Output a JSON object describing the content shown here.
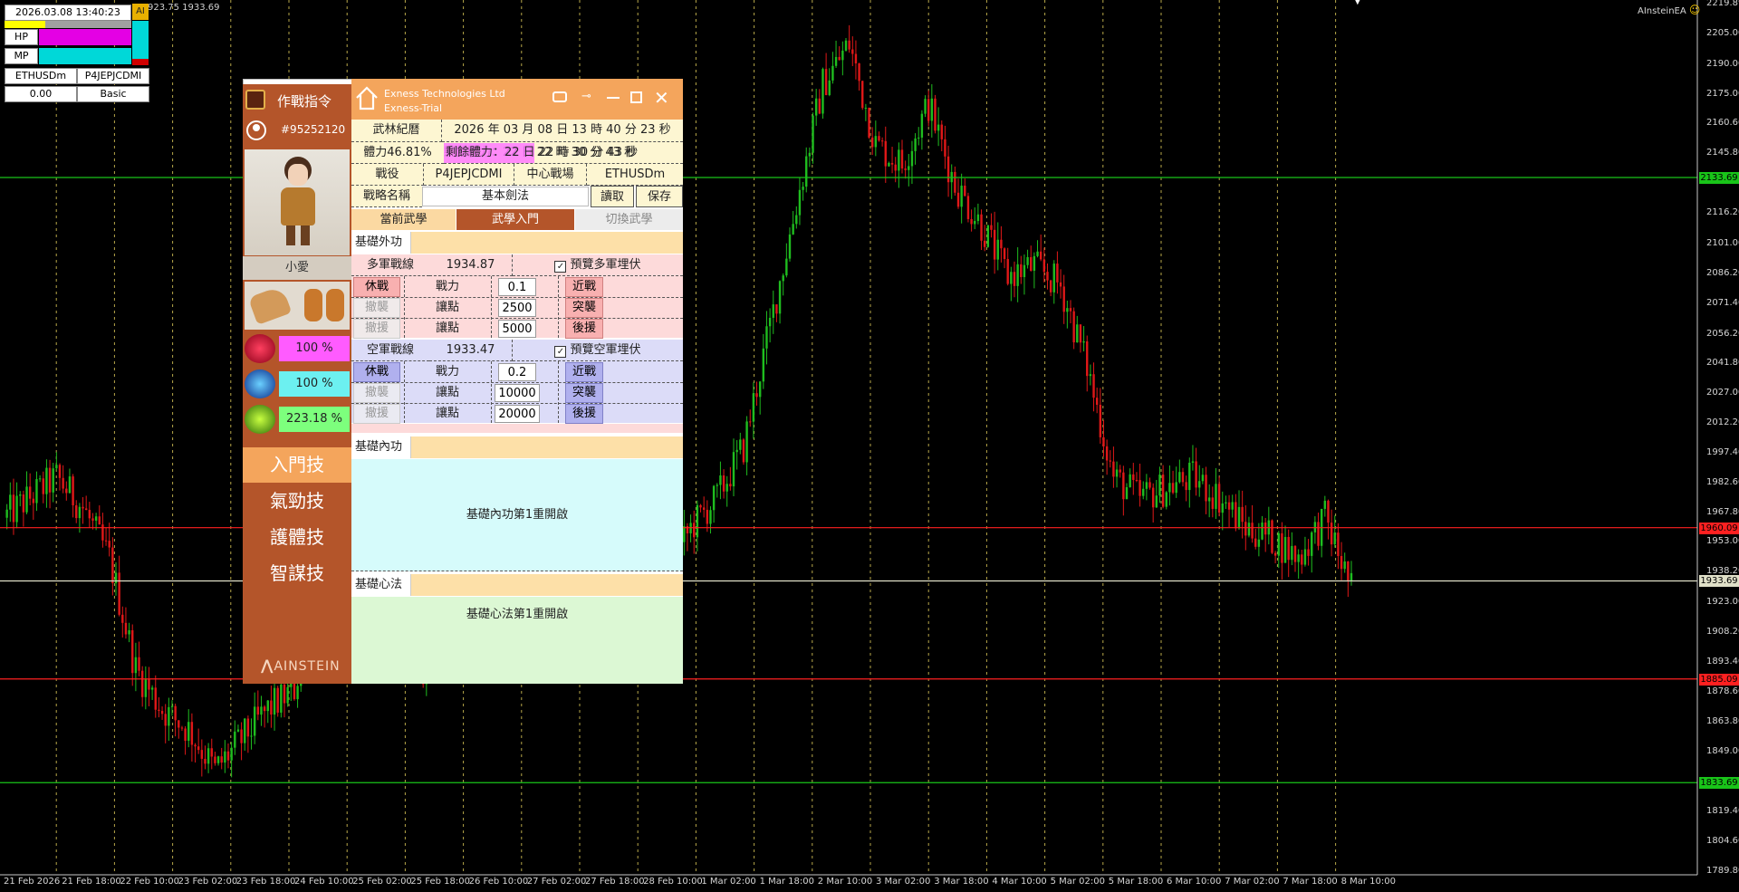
{
  "chart_data": {
    "type": "candlestick",
    "symbol": "ETHUSDm",
    "xlabels": [
      "21 Feb 2026",
      "21 Feb 18:00",
      "22 Feb 10:00",
      "23 Feb 02:00",
      "23 Feb 18:00",
      "24 Feb 10:00",
      "25 Feb 02:00",
      "25 Feb 18:00",
      "26 Feb 10:00",
      "27 Feb 02:00",
      "27 Feb 18:00",
      "28 Feb 10:00",
      "1 Mar 02:00",
      "1 Mar 18:00",
      "2 Mar 10:00",
      "3 Mar 02:00",
      "3 Mar 18:00",
      "4 Mar 10:00",
      "5 Mar 02:00",
      "5 Mar 18:00",
      "6 Mar 10:00",
      "7 Mar 02:00",
      "7 Mar 18:00",
      "8 Mar 10:00"
    ],
    "ylabels": [
      "2219.89",
      "2205.00",
      "2190.00",
      "2175.00",
      "2160.60",
      "2145.80",
      "2131.60",
      "2116.20",
      "2101.00",
      "2086.20",
      "2071.40",
      "2056.20",
      "2041.80",
      "2027.00",
      "2012.20",
      "1997.40",
      "1982.60",
      "1967.80",
      "1953.00",
      "1938.20",
      "1923.00",
      "1908.20",
      "1893.40",
      "1878.60",
      "1863.80",
      "1849.00",
      "1834.20",
      "1819.40",
      "1804.60",
      "1789.80"
    ],
    "ylim": [
      1789.8,
      2219.89
    ],
    "close_points": [
      [
        0,
        1965
      ],
      [
        8,
        1975
      ],
      [
        16,
        1985
      ],
      [
        24,
        1970
      ],
      [
        32,
        1945
      ],
      [
        40,
        1890
      ],
      [
        48,
        1870
      ],
      [
        56,
        1860
      ],
      [
        64,
        1840
      ],
      [
        72,
        1855
      ],
      [
        80,
        1870
      ],
      [
        88,
        1880
      ],
      [
        96,
        1930
      ],
      [
        104,
        1920
      ],
      [
        112,
        1935
      ],
      [
        120,
        1900
      ],
      [
        128,
        1890
      ],
      [
        136,
        1955
      ],
      [
        144,
        1950
      ],
      [
        152,
        2000
      ],
      [
        160,
        2030
      ],
      [
        168,
        1990
      ],
      [
        176,
        1960
      ],
      [
        184,
        1940
      ],
      [
        192,
        1925
      ],
      [
        200,
        1935
      ],
      [
        208,
        1960
      ],
      [
        216,
        1975
      ],
      [
        224,
        2000
      ],
      [
        232,
        2060
      ],
      [
        240,
        2120
      ],
      [
        248,
        2180
      ],
      [
        256,
        2200
      ],
      [
        264,
        2150
      ],
      [
        272,
        2140
      ],
      [
        280,
        2170
      ],
      [
        288,
        2130
      ],
      [
        296,
        2110
      ],
      [
        304,
        2085
      ],
      [
        312,
        2090
      ],
      [
        320,
        2080
      ],
      [
        328,
        2040
      ],
      [
        336,
        1985
      ],
      [
        344,
        1975
      ],
      [
        352,
        1980
      ],
      [
        360,
        1985
      ],
      [
        368,
        1975
      ],
      [
        376,
        1960
      ],
      [
        384,
        1955
      ],
      [
        392,
        1945
      ],
      [
        400,
        1965
      ],
      [
        408,
        1930
      ]
    ],
    "horizontal_lines": [
      {
        "price": "2133.69",
        "color": "#19c419"
      },
      {
        "price": "1960.09",
        "color": "#ff2020"
      },
      {
        "price": "1933.69",
        "color": "#e0e0c8"
      },
      {
        "price": "1885.09",
        "color": "#ff2020"
      },
      {
        "price": "1833.69",
        "color": "#19c419"
      }
    ]
  },
  "header": {
    "top_text": "923.75 1933.69",
    "ea_name": "AInsteinEA",
    "smiley": "☺",
    "arrow": "▼"
  },
  "info_panel": {
    "datetime": "2026.03.08 13:40:23",
    "ai_badge": "AI",
    "hp_label": "HP",
    "mp_label": "MP",
    "symbol": "ETHUSDm",
    "account": "P4JEPJCDMI",
    "value": "0.00",
    "mode": "Basic"
  },
  "left_panel": {
    "title": "作戰指令",
    "account_id": "#95252120",
    "character_name": "小愛",
    "hp_pct": "100 %",
    "mp_pct": "100 %",
    "exp_pct": "223.18 %",
    "menu": [
      "入門技",
      "氣勁技",
      "護體技",
      "智謀技"
    ],
    "logo": "AINSTEIN"
  },
  "window": {
    "broker": "Exness Technologies Ltd",
    "server": "Exness-Trial",
    "calendar_label": "武林紀曆",
    "calendar_value": "2026 年 03 月 08 日 13 時 40 分 23 秒",
    "stamina": "體力46.81%",
    "remaining": "剩餘體力：22 日 22 時 30 分 43 秒",
    "battle_label": "戰役",
    "battle_value": "P4JEPJCDMI",
    "field_label": "中心戰場",
    "field_value": "ETHUSDm",
    "strategy_label": "戰略名稱",
    "strategy_value": "基本劍法",
    "read_btn": "讀取",
    "save_btn": "保存",
    "tabs": [
      "當前武學",
      "武學入門",
      "切換武學"
    ],
    "section1": "基礎外功",
    "long_label": "多軍戰線",
    "long_price": "1934.87",
    "long_preview": "預覽多軍埋伏",
    "short_label": "空軍戰線",
    "short_price": "1933.47",
    "short_preview": "預覽空軍埋伏",
    "rest_btn": "休戰",
    "withdraw_btn": "撤襲",
    "withdraw2_btn": "撤援",
    "power_label": "戰力",
    "yield_label": "讓點",
    "long_power": "0.1",
    "long_yield1": "2500",
    "long_yield2": "5000",
    "short_power": "0.2",
    "short_yield1": "10000",
    "short_yield2": "20000",
    "melee_btn": "近戰",
    "raid_btn": "突襲",
    "support_btn": "後援",
    "section2": "基礎內功",
    "section2_msg": "基礎內功第1重開啟",
    "section3": "基礎心法",
    "section3_msg": "基礎心法第1重開啟"
  }
}
